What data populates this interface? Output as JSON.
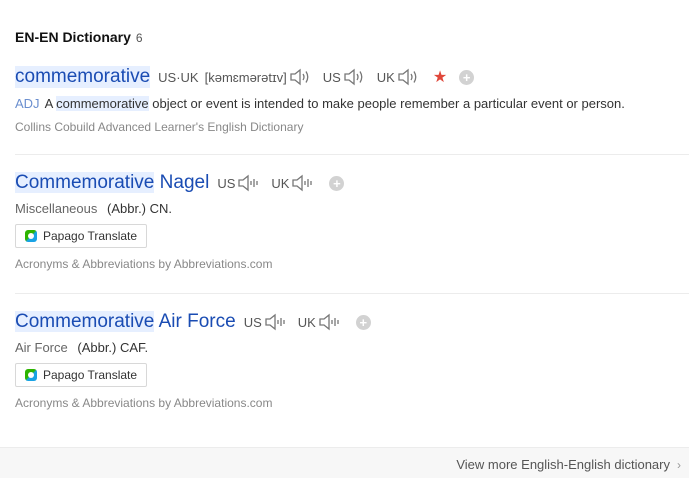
{
  "header": {
    "title": "EN-EN Dictionary",
    "count": "6"
  },
  "entries": [
    {
      "word": "commemorative",
      "pron_combined_label": "US·UK",
      "pron_ipa": "[kəmɛmərətɪv]",
      "us_label": "US",
      "uk_label": "UK",
      "pos": "ADJ",
      "def_before": "A",
      "def_highlight": "commemorative",
      "def_after": "object or event is intended to make people remember a particular event or person.",
      "source": "Collins Cobuild Advanced Learner's English Dictionary"
    },
    {
      "word_hl": "Commemorative",
      "word_rest": "Nagel",
      "us_label": "US",
      "uk_label": "UK",
      "category": "Miscellaneous",
      "meaning": "(Abbr.) CN.",
      "translate_label": "Papago Translate",
      "source": "Acronyms & Abbreviations by Abbreviations.com"
    },
    {
      "word_hl": "Commemorative",
      "word_rest": "Air Force",
      "us_label": "US",
      "uk_label": "UK",
      "category": "Air Force",
      "meaning": "(Abbr.) CAF.",
      "translate_label": "Papago Translate",
      "source": "Acronyms & Abbreviations by Abbreviations.com"
    }
  ],
  "footer": {
    "more_label": "View more English-English dictionary"
  },
  "colors": {
    "link": "#1a4cb3",
    "highlight": "#e6efff",
    "star": "#e0473a"
  }
}
